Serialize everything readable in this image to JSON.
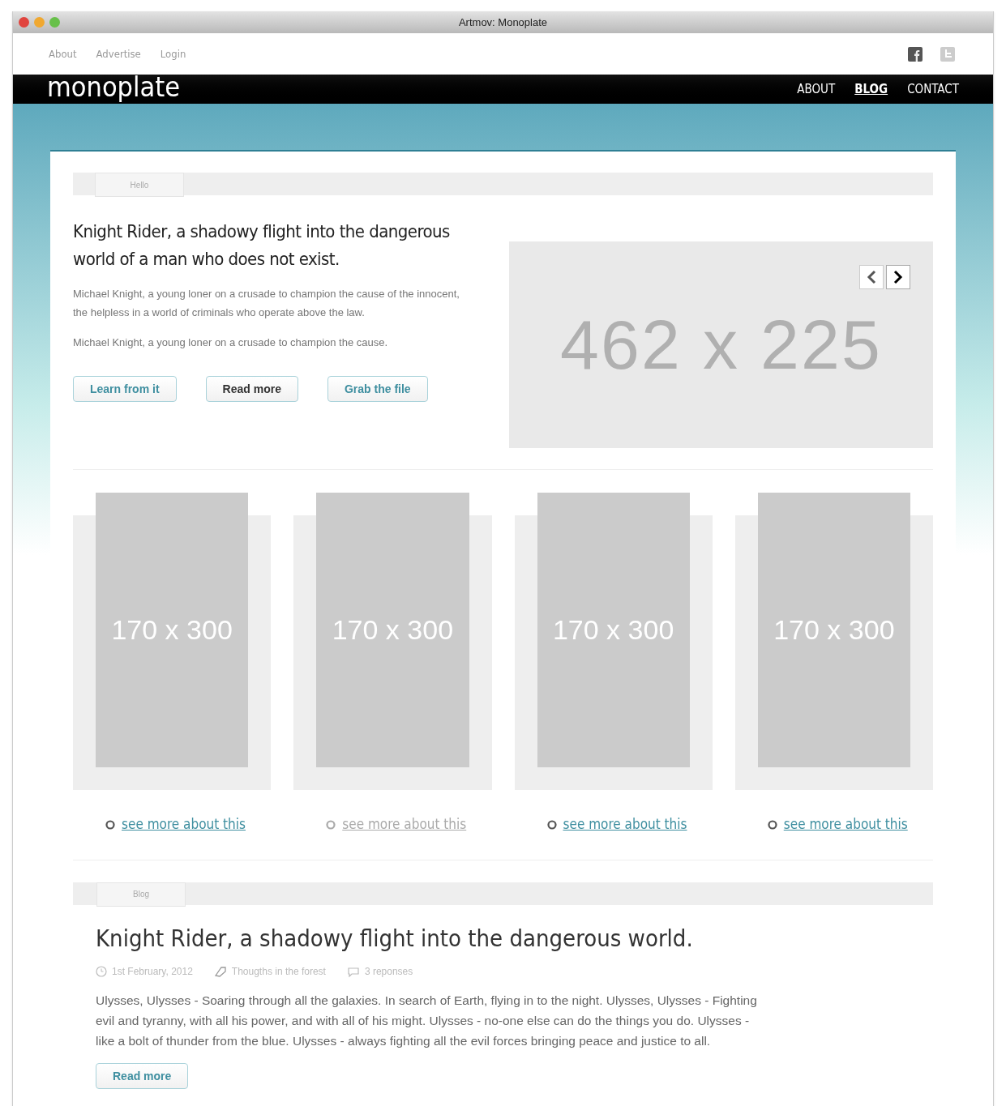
{
  "window": {
    "title": "Artmov: Monoplate"
  },
  "top_links": [
    "About",
    "Advertise",
    "Login"
  ],
  "logo": "monoplate",
  "nav": [
    {
      "label": "ABOUT",
      "selected": false
    },
    {
      "label": "BLOG",
      "selected": true
    },
    {
      "label": "CONTACT",
      "selected": false
    }
  ],
  "hero": {
    "tab": "Hello",
    "title": "Knight Rider, a shadowy flight into the dangerous world of a man who does not exist.",
    "paragraphs": [
      "Michael Knight, a young loner on a crusade to champion the cause of the innocent, the helpless in a world of criminals who operate above the law.",
      "Michael Knight, a young loner on a crusade to champion the cause."
    ],
    "buttons": [
      {
        "label": "Learn from it",
        "kind": "accent"
      },
      {
        "label": "Read more",
        "kind": "dark"
      },
      {
        "label": "Grab the file",
        "kind": "accent"
      }
    ],
    "slider_placeholder": "462 x 225"
  },
  "tiles": [
    {
      "placeholder": "170 x 300",
      "link": "see more about this",
      "disabled": false
    },
    {
      "placeholder": "170 x 300",
      "link": "see more about this",
      "disabled": true
    },
    {
      "placeholder": "170 x 300",
      "link": "see more about this",
      "disabled": false
    },
    {
      "placeholder": "170 x 300",
      "link": "see more about this",
      "disabled": false
    }
  ],
  "blog": {
    "tab": "Blog",
    "title": "Knight Rider, a shadowy flight into the dangerous world.",
    "meta": [
      {
        "kind": "date",
        "text": "1st February, 2012"
      },
      {
        "kind": "tag",
        "text": "Thougths in the forest"
      },
      {
        "kind": "comments",
        "text": "3 reponses"
      }
    ],
    "body": "Ulysses, Ulysses - Soaring through all the galaxies. In search of Earth, flying in to the night. Ulysses, Ulysses - Fighting evil and tyranny, with all his power, and with all of his might. Ulysses - no-one else can do the things you do. Ulysses - like a bolt of thunder from the blue. Ulysses - always fighting all the evil forces bringing peace and justice to all.",
    "button": "Read more"
  }
}
